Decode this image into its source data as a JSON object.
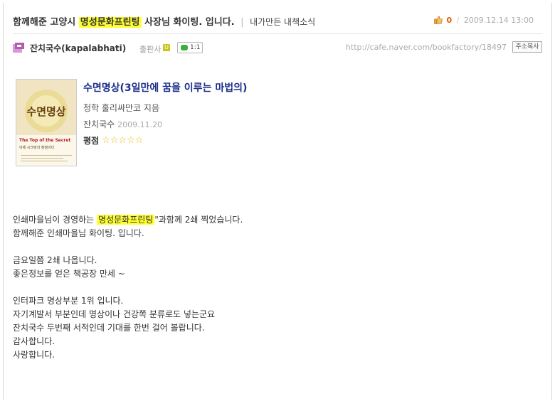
{
  "post": {
    "title_prefix": "함께해준 고양시",
    "title_highlight": "명성문화프린팅",
    "title_suffix": "사장님 화이팅. 입니다.",
    "separator": "|",
    "category": "내가만든 내책소식",
    "likes": "0",
    "date_sep": "/",
    "date": "2009.12.14 13:00"
  },
  "author": {
    "nickname": "잔치국수(kapalabhati)",
    "role": "출판사",
    "level": "U",
    "chat_count": "1:1",
    "url": "http://cafe.naver.com/bookfactory/18497",
    "copy_button": "주소복사"
  },
  "book": {
    "title": "수면명상(3일만에 꿈을 이루는 마법의)",
    "author_line": "청학 훌리싸만코 지음",
    "reviewer": "잔치국수",
    "review_date": "2009.11.20",
    "rating_label": "평점",
    "rating": 5,
    "cover_title": "수면명상",
    "cover_subtitle": "The Top of the Secret",
    "cover_tagline": "이제 시크릿의 정점이다"
  },
  "body": {
    "line1_prefix": "인쇄마을님이 경영하는",
    "line1_highlight": "명성문화프린팅",
    "line1_suffix": "\"과함께 2쇄 찍었습니다.",
    "line2": "함께해준 인쇄마을님 화이팅. 입니다.",
    "line3": "금요일쯤 2쇄 나옵니다.",
    "line4": "좋은정보를 얻은 책공장 만세 ~",
    "line5": "인터파크 명상부분 1위 입니다.",
    "line6": "자기계발서 부분인데  명상이나 건강쪽 분류로도 넣는군요",
    "line7": "잔치국수 두번째 서적인데 기대를 한번 걸어 볼랍니다.",
    "line8": "감사합니다.",
    "line9": "사랑합니다."
  },
  "colors": {
    "highlight": "#ffff33",
    "book_title": "#1c2e8a",
    "likes": "#e05b00",
    "star": "#f0b800"
  }
}
